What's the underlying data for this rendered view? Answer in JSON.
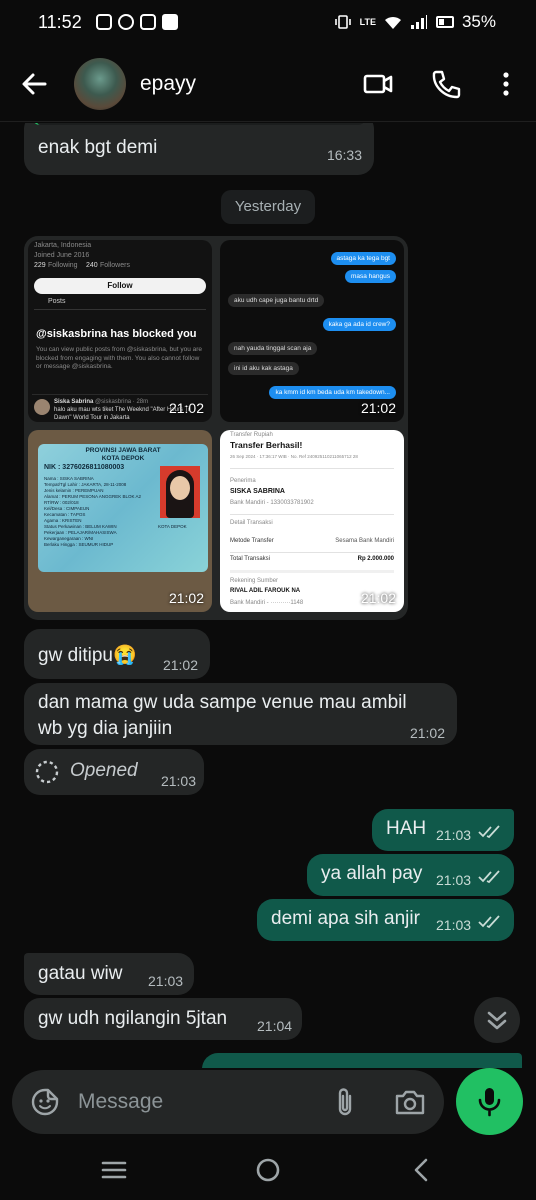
{
  "status": {
    "time": "11:52",
    "battery": "35%",
    "network": "LTE"
  },
  "header": {
    "contact_name": "epayy",
    "icons": [
      "back-arrow-icon",
      "video-call-icon",
      "phone-call-icon",
      "more-vert-icon"
    ]
  },
  "chat": {
    "first_message": {
      "text": "enak bgt demi",
      "time": "16:33"
    },
    "date_separator": "Yesterday",
    "album": {
      "tiles": [
        {
          "time": "21:02",
          "location": "Jakarta, Indonesia",
          "joined": "Joined June 2016",
          "following": "229",
          "following_label": "Following",
          "followers": "240",
          "followers_label": "Followers",
          "follow_button": "Follow",
          "posts_tab": "Posts",
          "blocked_title": "@siskasbrina has blocked you",
          "blocked_text": "You can view public posts from @siskasbrina, but you are blocked from engaging with them. You also cannot follow or message @siskasbrina.",
          "post_author": "Siska Sabrina",
          "post_handle": "@siskasbrina · 28m",
          "post_text": "halo aku mau wts tiket The Weeknd \"After Hours Til Dawn\" World Tour in Jakarta"
        },
        {
          "time": "21:02",
          "messages": [
            {
              "side": "right",
              "text": "astaga ka tega bgt"
            },
            {
              "side": "right",
              "text": "masa hangus"
            },
            {
              "side": "left",
              "text": "aku udh cape juga bantu drtd"
            },
            {
              "side": "right",
              "text": "kaka ga ada id crew?"
            },
            {
              "side": "left",
              "text": "nah yauda tinggal scan aja"
            },
            {
              "side": "left",
              "text": "ini id aku kak astaga"
            },
            {
              "side": "right",
              "text": "ka kmm id km beda uda km takedown..."
            }
          ]
        },
        {
          "time": "21:02",
          "province": "PROVINSI JAWA BARAT",
          "city": "KOTA DEPOK",
          "nik_label": "NIK",
          "nik": "3276026811080003",
          "name": "SISKA SABRINA",
          "issue_city": "KOTA DEPOK",
          "fields": [
            "Nama : SISKA SABRINA",
            "Tempat/Tgl Lahir : JAKARTA, 28-11-2008",
            "Jenis kelamin : PEREMPUAN",
            "Alamat : PERUM PESONA ANGGREK BLOK A2",
            "RT/RW : 002/018",
            "Kel/Desa : CIMPAEUN",
            "Kecamatan : TAPOS",
            "Agama : KRISTEN",
            "Status Perkawinan : BELUM KAWIN",
            "Pekerjaan : PELAJAR/MAHASISWA",
            "Kewarganegaraan : WNI",
            "Berlaku Hingga : SEUMUR HIDUP"
          ]
        },
        {
          "time": "21:02",
          "header": "Transfer Rupiah",
          "title": "Transfer Berhasil!",
          "meta": "26 Sep 2024 · 17:36:17 WIB · No. Ref 240925110211065712 28",
          "recipient_label": "Penerima",
          "recipient_name": "SISKA SABRINA",
          "recipient_bank": "Bank Mandiri - 1330033781902",
          "details_label": "Detail Transaksi",
          "method_label": "Metode Transfer",
          "method_value": "Sesama Bank Mandiri",
          "total_label": "Total Transaksi",
          "total_value": "Rp 2.000.000",
          "source_label": "Rekening Sumber",
          "source_name": "RIVAL ADIL FAROUK NA",
          "source_bank": "Bank Mandiri - ··········1148"
        }
      ]
    },
    "messages": [
      {
        "text": "gw ditipu😭",
        "time": "21:02"
      },
      {
        "text": "dan mama gw uda sampe venue mau ambil wb yg dia janjiin",
        "time": "21:02"
      },
      {
        "text": "Opened",
        "time": "21:03"
      },
      {
        "text": "HAH",
        "time": "21:03"
      },
      {
        "text": "ya allah pay",
        "time": "21:03"
      },
      {
        "text": "demi apa sih anjir",
        "time": "21:03"
      },
      {
        "text": "gatau wiw",
        "time": "21:03"
      },
      {
        "text": "gw udh ngilangin 5jtan",
        "time": "21:04"
      }
    ],
    "wrapped_lines": [
      "dan mama gw uda sampe venue mau ambil",
      "wb yg dia janjiin"
    ]
  },
  "compose": {
    "placeholder": "Message",
    "icons": [
      "emoji-sticker-icon",
      "attach-icon",
      "camera-icon",
      "mic-icon"
    ]
  },
  "navbar": {
    "icons": [
      "recent-apps-icon",
      "home-icon",
      "back-icon"
    ]
  },
  "colors": {
    "background": "#0b0b0b",
    "incoming_bubble": "#242626",
    "outgoing_bubble": "#10594a",
    "accent_green": "#21c063",
    "receipt_bubble": "#1d8ef0"
  }
}
